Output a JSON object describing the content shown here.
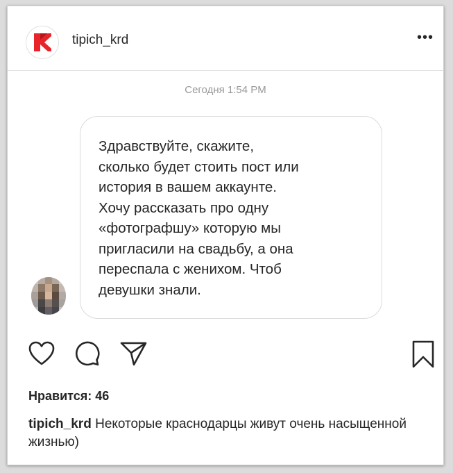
{
  "post": {
    "username": "tipich_krd",
    "more_label": "•••",
    "icons": {
      "logo": "brand-logo-icon",
      "more": "more-options-icon",
      "like": "heart-icon",
      "comment": "comment-icon",
      "share": "share-icon",
      "save": "bookmark-icon"
    }
  },
  "message": {
    "timestamp": "Сегодня 1:54 PM",
    "text": "Здравствуйте, скажите,\nсколько будет стоить пост или\nистория в вашем аккаунте.\nХочу рассказать про одну\n«фотографшу» которую мы\nпригласили на свадьбу, а она\nпереспала с женихом. Чтоб\nдевушки знали."
  },
  "engagement": {
    "likes_text": "Нравится: 46"
  },
  "caption": {
    "username": "tipich_krd",
    "text": "Некоторые краснодарцы живут очень насыщенной жизнью)"
  },
  "colors": {
    "brand_red": "#e8242a",
    "text": "#262626",
    "muted": "#999999"
  }
}
